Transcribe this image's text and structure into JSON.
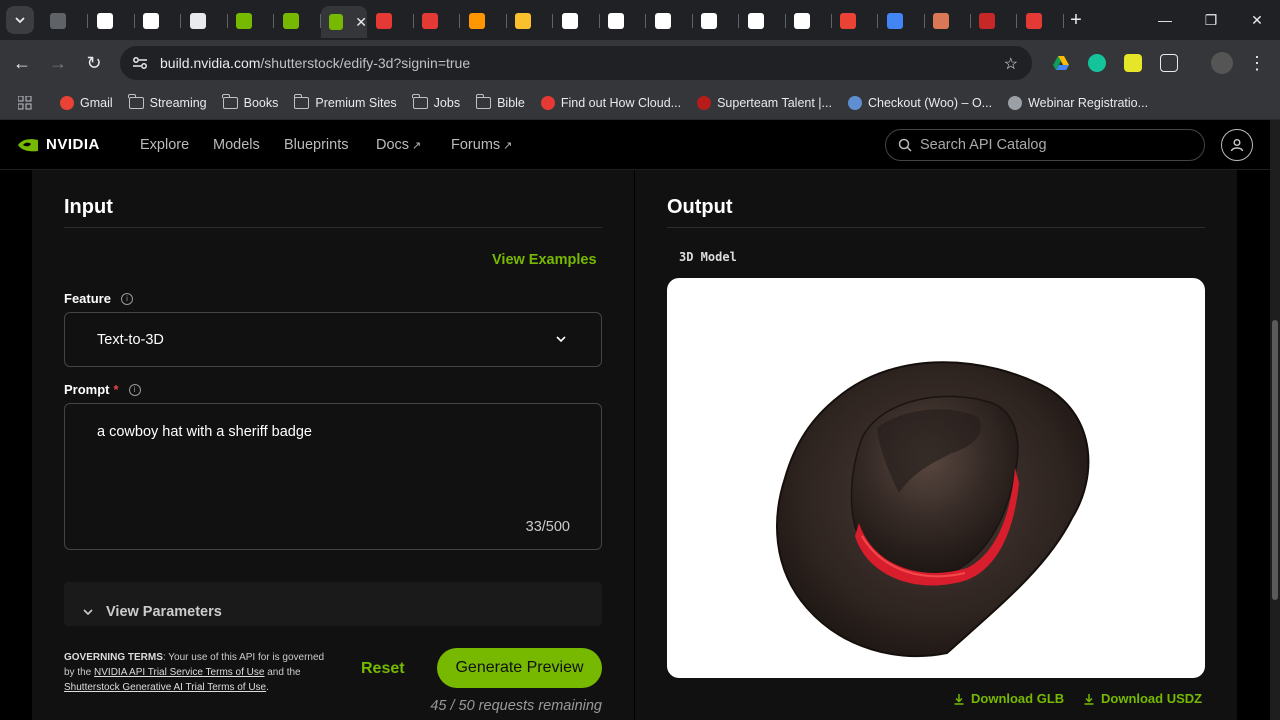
{
  "browser": {
    "tabs": [
      {
        "favicon": "gray-icon",
        "color": "#5f6368"
      },
      {
        "favicon": "triangle-icon",
        "color": "#ffffff"
      },
      {
        "favicon": "triangle-icon",
        "color": "#ffffff"
      },
      {
        "favicon": "app-icon",
        "color": "#e8eaed"
      },
      {
        "favicon": "nvidia-icon",
        "color": "#76b900"
      },
      {
        "favicon": "nvidia-icon",
        "color": "#76b900"
      },
      {
        "favicon": "nvidia-icon",
        "color": "#76b900",
        "active": true
      },
      {
        "favicon": "g-icon",
        "color": "#e53935"
      },
      {
        "favicon": "g-icon",
        "color": "#e53935"
      },
      {
        "favicon": "m-icon",
        "color": "#ff9800"
      },
      {
        "favicon": "chat-icon",
        "color": "#fbc02d"
      },
      {
        "favicon": "openai-icon",
        "color": "#ffffff"
      },
      {
        "favicon": "x-icon",
        "color": "#ffffff"
      },
      {
        "favicon": "openai-icon",
        "color": "#ffffff"
      },
      {
        "favicon": "openai-icon",
        "color": "#ffffff"
      },
      {
        "favicon": "openai-icon",
        "color": "#ffffff"
      },
      {
        "favicon": "openai-icon",
        "color": "#ffffff"
      },
      {
        "favicon": "gmail-icon",
        "color": "#ea4335"
      },
      {
        "favicon": "docs-icon",
        "color": "#4285f4"
      },
      {
        "favicon": "claude-icon",
        "color": "#d97757"
      },
      {
        "favicon": "arc-icon",
        "color": "#c62828"
      },
      {
        "favicon": "swirl-icon",
        "color": "#e53935"
      }
    ],
    "url_host": "build.nvidia.com",
    "url_path": "/shutterstock/edify-3d?signin=true",
    "bookmarks": [
      {
        "label": "Gmail",
        "icon": "gmail-icon"
      },
      {
        "label": "Streaming",
        "icon": "folder-icon"
      },
      {
        "label": "Books",
        "icon": "folder-icon"
      },
      {
        "label": "Premium Sites",
        "icon": "folder-icon"
      },
      {
        "label": "Jobs",
        "icon": "folder-icon"
      },
      {
        "label": "Bible",
        "icon": "folder-icon"
      },
      {
        "label": "Find out How Cloud...",
        "icon": "cloud-icon"
      },
      {
        "label": "Superteam Talent |...",
        "icon": "superteam-icon"
      },
      {
        "label": "Checkout (Woo) – O...",
        "icon": "checkout-icon"
      },
      {
        "label": "Webinar Registratio...",
        "icon": "globe-icon"
      }
    ]
  },
  "site": {
    "logo": "NVIDIA",
    "nav": [
      "Explore",
      "Models",
      "Blueprints",
      "Docs",
      "Forums"
    ],
    "search_placeholder": "Search API Catalog"
  },
  "input_panel": {
    "title": "Input",
    "view_examples": "View Examples",
    "feature_label": "Feature",
    "feature_value": "Text-to-3D",
    "prompt_label": "Prompt",
    "prompt_required": "*",
    "prompt_value": "a cowboy hat with a sheriff badge",
    "prompt_counter": "33/500",
    "view_parameters": "View Parameters",
    "terms": {
      "heading": "GOVERNING TERMS",
      "text1": ": Your use of this API for is governed by the ",
      "link1": "NVIDIA API Trial Service Terms of Use",
      "text2": " and the ",
      "link2": "Shutterstock Generative AI Trial Terms of Use",
      "text3": "."
    },
    "reset": "Reset",
    "generate": "Generate Preview",
    "remaining": "45 / 50 requests remaining"
  },
  "output_panel": {
    "title": "Output",
    "model_label": "3D Model",
    "download_glb": "Download GLB",
    "download_usdz": "Download USDZ"
  },
  "colors": {
    "accent": "#76b900",
    "hat_band": "#d81e2c",
    "hat_leather": "#3b2f2b"
  }
}
